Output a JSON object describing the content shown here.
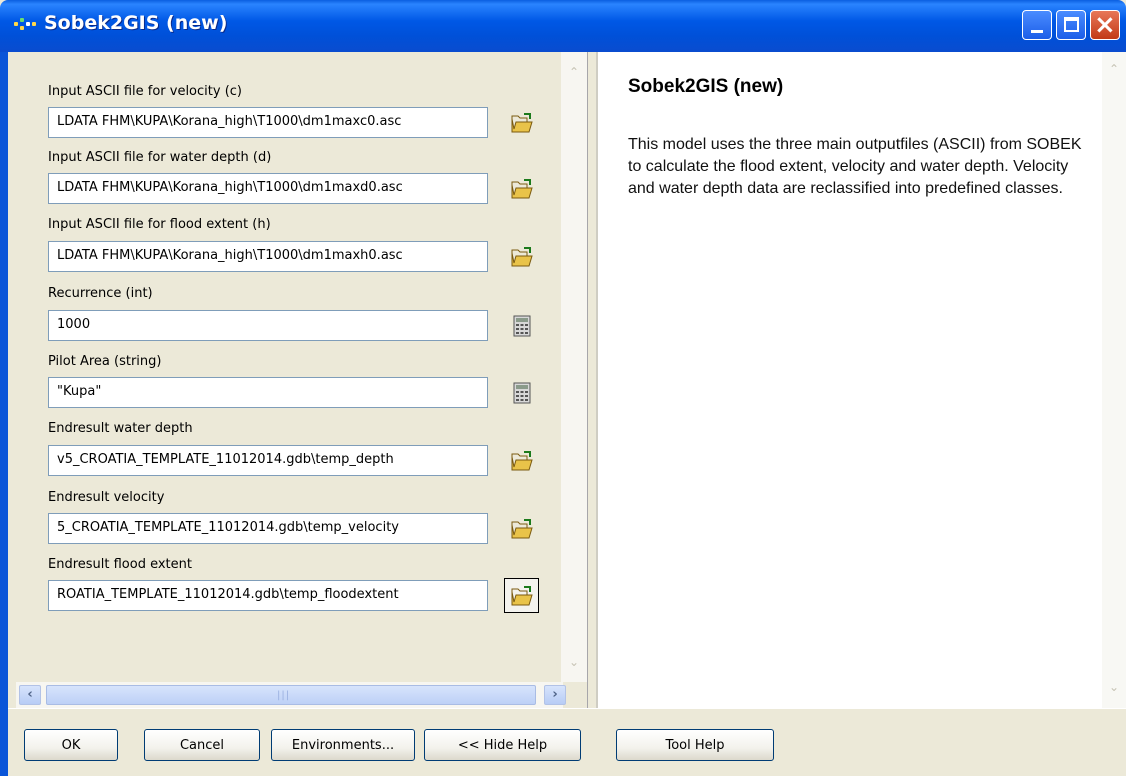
{
  "window": {
    "title": "Sobek2GIS (new)"
  },
  "params": [
    {
      "label": "Input ASCII file for velocity (c)",
      "value": "LDATA FHM\\KUPA\\Korana_high\\T1000\\dm1maxc0.asc",
      "button": "browse"
    },
    {
      "label": "Input ASCII file for water depth (d)",
      "value": "LDATA FHM\\KUPA\\Korana_high\\T1000\\dm1maxd0.asc",
      "button": "browse"
    },
    {
      "label": "Input ASCII file for flood extent (h)",
      "value": "LDATA FHM\\KUPA\\Korana_high\\T1000\\dm1maxh0.asc",
      "button": "browse"
    },
    {
      "label": "Recurrence (int)",
      "value": "1000",
      "button": "calculator"
    },
    {
      "label": "Pilot Area (string)",
      "value": "\"Kupa\"",
      "button": "calculator"
    },
    {
      "label": "Endresult water depth",
      "value": "v5_CROATIA_TEMPLATE_11012014.gdb\\temp_depth",
      "button": "browse"
    },
    {
      "label": "Endresult velocity",
      "value": "5_CROATIA_TEMPLATE_11012014.gdb\\temp_velocity",
      "button": "browse"
    },
    {
      "label": "Endresult flood extent",
      "value": "ROATIA_TEMPLATE_11012014.gdb\\temp_floodextent",
      "button": "browse"
    }
  ],
  "help": {
    "title": "Sobek2GIS (new)",
    "body": "This model uses the three main outputfiles (ASCII) from SOBEK to calculate the flood extent, velocity and water depth. Velocity and water depth data are reclassified into predefined classes."
  },
  "buttons": {
    "ok": "OK",
    "cancel": "Cancel",
    "environments": "Environments...",
    "hide_help": "<< Hide Help",
    "tool_help": "Tool Help"
  },
  "colors": {
    "titlebar": "#0054e3",
    "dialog_bg": "#ece9d8",
    "input_border": "#7f9db9"
  }
}
